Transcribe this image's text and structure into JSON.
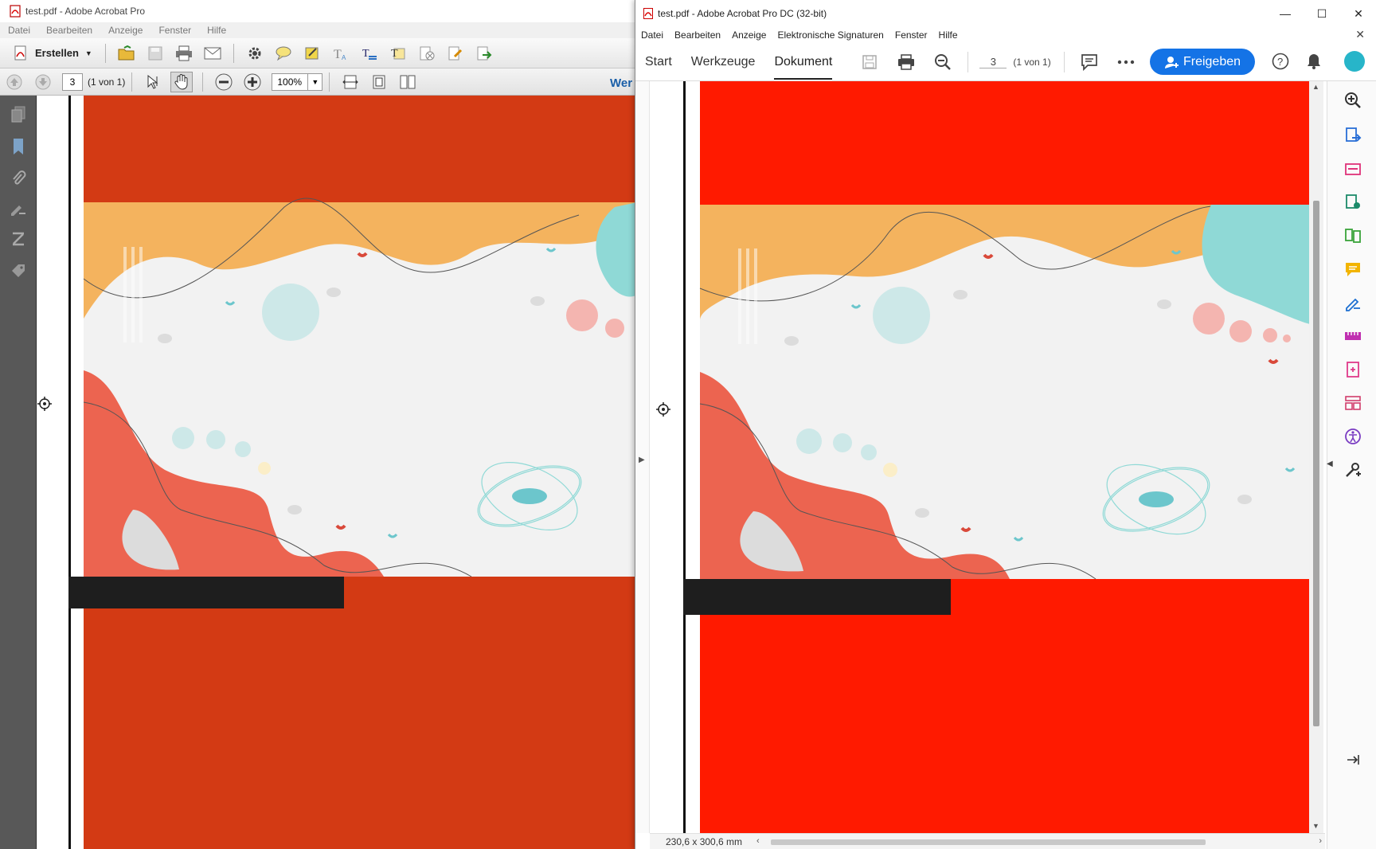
{
  "left_window": {
    "title": "test.pdf - Adobe Acrobat Pro",
    "menu": [
      "Datei",
      "Bearbeiten",
      "Anzeige",
      "Fenster",
      "Hilfe"
    ],
    "toolbar": {
      "create_label": "Erstellen",
      "page_number": "3",
      "page_count": "(1 von 1)",
      "zoom": "100%",
      "truncated_link": "Wer"
    }
  },
  "right_window": {
    "title": "test.pdf - Adobe Acrobat Pro DC (32-bit)",
    "menu": [
      "Datei",
      "Bearbeiten",
      "Anzeige",
      "Elektronische Signaturen",
      "Fenster",
      "Hilfe"
    ],
    "tabs": [
      "Start",
      "Werkzeuge",
      "Dokument"
    ],
    "active_tab": "Dokument",
    "page_number": "3",
    "page_count": "(1 von 1)",
    "share_label": "Freigeben",
    "page_size": "230,6 x 300,6 mm"
  },
  "colors": {
    "left_red": "#d33a14",
    "right_red": "#ff1a00",
    "orange": "#f4b35e",
    "teal": "#8fd9d6",
    "coral": "#ec6450",
    "black_bar": "#1e1e1e",
    "share_blue": "#1473e6"
  },
  "icons": {
    "left_panel": [
      "pages-icon",
      "bookmark-icon",
      "attachment-icon",
      "signature-icon",
      "layers-icon",
      "tag-icon"
    ],
    "right_panel": [
      "zoom-in-icon",
      "export-pdf-icon",
      "organize-pages-icon",
      "create-pdf-icon",
      "compare-icon",
      "comment-icon",
      "fill-sign-icon",
      "measure-icon",
      "edit-pdf-icon",
      "forms-icon",
      "accessibility-icon",
      "more-tools-icon"
    ]
  }
}
